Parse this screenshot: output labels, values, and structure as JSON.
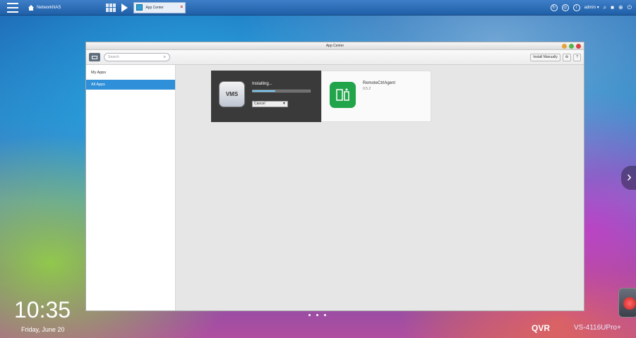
{
  "taskbar": {
    "home_label": "NetworkNAS",
    "active_tab": "App Center",
    "user_label": "admin",
    "icons": [
      "menu-icon",
      "home-icon",
      "apps-grid-icon",
      "play-icon",
      "refresh-icon",
      "activity-icon",
      "info-icon",
      "search-icon",
      "notification-icon",
      "network-icon",
      "power-icon"
    ]
  },
  "window": {
    "title": "App Center",
    "toolbar": {
      "search_placeholder": "Search",
      "install_manually": "Install Manually",
      "settings_label": "?",
      "help_label": "?"
    },
    "sidebar": {
      "items": [
        {
          "label": "My Apps",
          "active": false
        },
        {
          "label": "All Apps",
          "active": true
        }
      ]
    },
    "apps": [
      {
        "name": "VMS",
        "status": "Installing...",
        "progress": 0.4,
        "action": "Cancel"
      },
      {
        "name": "RemoteCtrlAgent",
        "version": "0.5.2"
      }
    ]
  },
  "desktop": {
    "time": "10:35",
    "date": "Friday, June 20",
    "brand": "QVR",
    "model": "VS-4116UPro+",
    "page_dots": 3
  },
  "colors": {
    "accent": "#2f8fd8",
    "taskbar": "#2a6db8",
    "progress": "#6cc4ee",
    "app_green": "#22a44a"
  }
}
